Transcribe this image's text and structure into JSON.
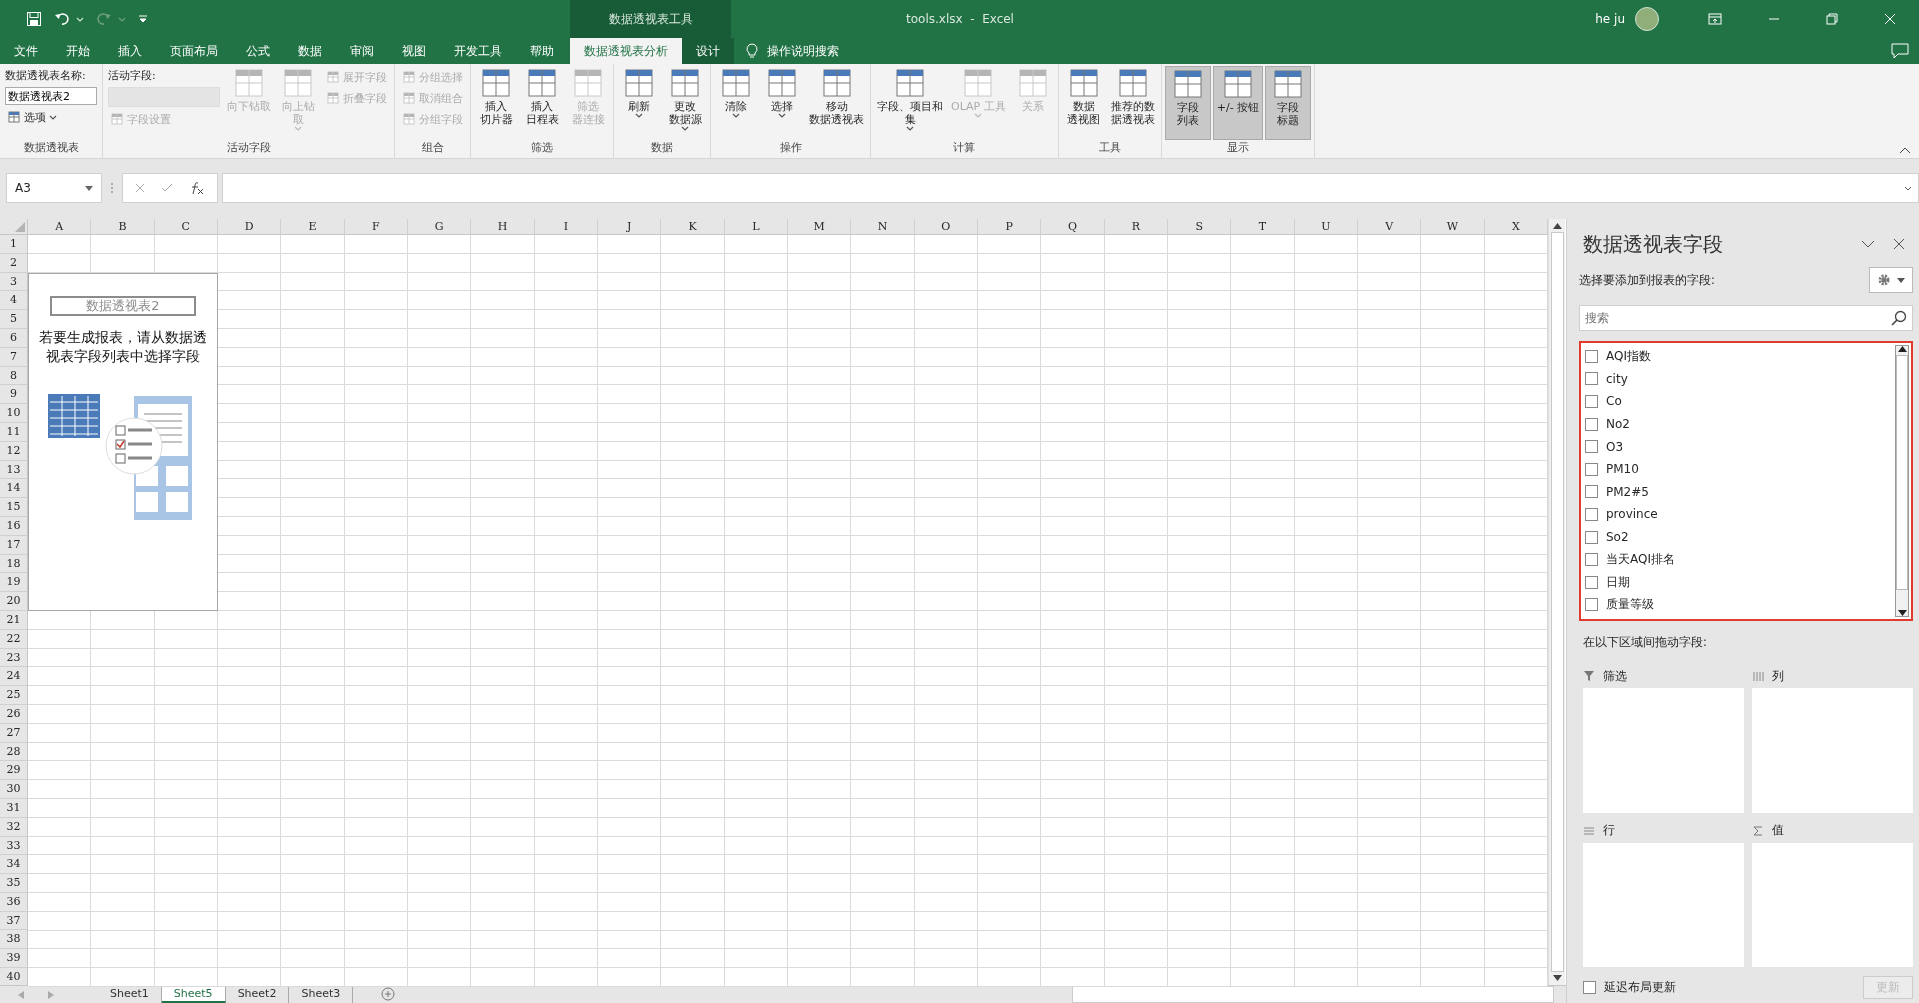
{
  "title_bar": {
    "context_label": "数据透视表工具",
    "title": "tools.xlsx  -  Excel",
    "user": "he ju",
    "redo_disabled": true
  },
  "ribbon_tabs": [
    {
      "label": "文件",
      "selected": false,
      "contextual": false
    },
    {
      "label": "开始",
      "selected": false,
      "contextual": false
    },
    {
      "label": "插入",
      "selected": false,
      "contextual": false
    },
    {
      "label": "页面布局",
      "selected": false,
      "contextual": false
    },
    {
      "label": "公式",
      "selected": false,
      "contextual": false
    },
    {
      "label": "数据",
      "selected": false,
      "contextual": false
    },
    {
      "label": "审阅",
      "selected": false,
      "contextual": false
    },
    {
      "label": "视图",
      "selected": false,
      "contextual": false
    },
    {
      "label": "开发工具",
      "selected": false,
      "contextual": false
    },
    {
      "label": "帮助",
      "selected": false,
      "contextual": false
    },
    {
      "label": "数据透视表分析",
      "selected": true,
      "contextual": true
    },
    {
      "label": "设计",
      "selected": false,
      "contextual": true
    }
  ],
  "tell_me": "操作说明搜索",
  "ribbon_groups": [
    {
      "label": "数据透视表",
      "items": [
        {
          "kind": "stack",
          "items": [
            {
              "kind": "caption",
              "label": "数据透视表名称:"
            },
            {
              "kind": "name_field",
              "value": "数据透视表2"
            },
            {
              "kind": "small",
              "label": "选项",
              "disabled": false,
              "dropdown": true
            }
          ]
        }
      ]
    },
    {
      "label": "活动字段",
      "items": [
        {
          "kind": "stack",
          "items": [
            {
              "kind": "caption",
              "label": "活动字段:"
            },
            {
              "kind": "active_field",
              "disabled": true
            },
            {
              "kind": "small",
              "label": "字段设置",
              "disabled": true,
              "dropdown": false
            }
          ]
        },
        {
          "kind": "large",
          "label": [
            "向下钻取"
          ],
          "disabled": true,
          "dropdown": false,
          "pressed": false
        },
        {
          "kind": "large",
          "label": [
            "向上钻",
            "取"
          ],
          "disabled": true,
          "dropdown": true,
          "pressed": false
        },
        {
          "kind": "stack",
          "items": [
            {
              "kind": "small",
              "label": "展开字段",
              "disabled": true,
              "dropdown": false
            },
            {
              "kind": "small",
              "label": "折叠字段",
              "disabled": true,
              "dropdown": false
            }
          ]
        }
      ]
    },
    {
      "label": "组合",
      "items": [
        {
          "kind": "stack",
          "items": [
            {
              "kind": "small",
              "label": "分组选择",
              "disabled": true,
              "dropdown": false
            },
            {
              "kind": "small",
              "label": "取消组合",
              "disabled": true,
              "dropdown": false
            },
            {
              "kind": "small",
              "label": "分组字段",
              "disabled": true,
              "dropdown": false
            }
          ]
        }
      ]
    },
    {
      "label": "筛选",
      "items": [
        {
          "kind": "large",
          "label": [
            "插入",
            "切片器"
          ],
          "disabled": false,
          "dropdown": false,
          "pressed": false
        },
        {
          "kind": "large",
          "label": [
            "插入",
            "日程表"
          ],
          "disabled": false,
          "dropdown": false,
          "pressed": false
        },
        {
          "kind": "large",
          "label": [
            "筛选",
            "器连接"
          ],
          "disabled": true,
          "dropdown": false,
          "pressed": false
        }
      ]
    },
    {
      "label": "数据",
      "items": [
        {
          "kind": "large",
          "label": [
            "刷新"
          ],
          "disabled": false,
          "dropdown": true,
          "pressed": false
        },
        {
          "kind": "large",
          "label": [
            "更改",
            "数据源"
          ],
          "disabled": false,
          "dropdown": true,
          "pressed": false
        }
      ]
    },
    {
      "label": "操作",
      "items": [
        {
          "kind": "large",
          "label": [
            "清除"
          ],
          "disabled": false,
          "dropdown": true,
          "pressed": false
        },
        {
          "kind": "large",
          "label": [
            "选择"
          ],
          "disabled": false,
          "dropdown": true,
          "pressed": false
        },
        {
          "kind": "large",
          "label": [
            "移动",
            "数据透视表"
          ],
          "disabled": false,
          "dropdown": false,
          "pressed": false
        }
      ]
    },
    {
      "label": "计算",
      "items": [
        {
          "kind": "large",
          "label": [
            "字段、项目和",
            "集"
          ],
          "disabled": false,
          "dropdown": true,
          "pressed": false
        },
        {
          "kind": "large",
          "label": [
            "OLAP 工具"
          ],
          "disabled": true,
          "dropdown": true,
          "pressed": false
        },
        {
          "kind": "large",
          "label": [
            "关系"
          ],
          "disabled": true,
          "dropdown": false,
          "pressed": false
        }
      ]
    },
    {
      "label": "工具",
      "items": [
        {
          "kind": "large",
          "label": [
            "数据",
            "透视图"
          ],
          "disabled": false,
          "dropdown": false,
          "pressed": false
        },
        {
          "kind": "large",
          "label": [
            "推荐的数",
            "据透视表"
          ],
          "disabled": false,
          "dropdown": false,
          "pressed": false
        }
      ]
    },
    {
      "label": "显示",
      "items": [
        {
          "kind": "large",
          "label": [
            "字段",
            "列表"
          ],
          "disabled": false,
          "dropdown": false,
          "pressed": true
        },
        {
          "kind": "large",
          "label": [
            "+/- 按钮"
          ],
          "disabled": false,
          "dropdown": false,
          "pressed": true
        },
        {
          "kind": "large",
          "label": [
            "字段",
            "标题"
          ],
          "disabled": false,
          "dropdown": false,
          "pressed": true
        }
      ]
    }
  ],
  "formula_bar": {
    "name_box": "A3"
  },
  "sheet": {
    "columns": [
      "A",
      "B",
      "C",
      "D",
      "E",
      "F",
      "G",
      "H",
      "I",
      "J",
      "K",
      "L",
      "M",
      "N",
      "O",
      "P",
      "Q",
      "R",
      "S",
      "T",
      "U",
      "V",
      "W",
      "X"
    ],
    "rows": [
      "1",
      "2",
      "3",
      "4",
      "5",
      "6",
      "7",
      "8",
      "9",
      "10",
      "11",
      "12",
      "13",
      "14",
      "15",
      "16",
      "17",
      "18",
      "19",
      "20",
      "21",
      "22",
      "23",
      "24",
      "25",
      "26",
      "27",
      "28",
      "29",
      "30",
      "31",
      "32",
      "33",
      "34",
      "35",
      "36",
      "37",
      "38",
      "39",
      "40"
    ],
    "pivot_placeholder": {
      "title": "数据透视表2",
      "message": "若要生成报表，请从数据透视表字段列表中选择字段"
    }
  },
  "sheet_tabs": [
    {
      "label": "Sheet1",
      "selected": false
    },
    {
      "label": "Sheet5",
      "selected": true
    },
    {
      "label": "Sheet2",
      "selected": false
    },
    {
      "label": "Sheet3",
      "selected": false
    }
  ],
  "field_pane": {
    "title": "数据透视表字段",
    "subtitle": "选择要添加到报表的字段:",
    "search": {
      "placeholder": "搜索"
    },
    "fields": [
      {
        "label": "AQI指数",
        "checked": false
      },
      {
        "label": "city",
        "checked": false
      },
      {
        "label": "Co",
        "checked": false
      },
      {
        "label": "No2",
        "checked": false
      },
      {
        "label": "O3",
        "checked": false
      },
      {
        "label": "PM10",
        "checked": false
      },
      {
        "label": "PM2#5",
        "checked": false
      },
      {
        "label": "province",
        "checked": false
      },
      {
        "label": "So2",
        "checked": false
      },
      {
        "label": "当天AQI排名",
        "checked": false
      },
      {
        "label": "日期",
        "checked": false
      },
      {
        "label": "质量等级",
        "checked": false
      }
    ],
    "areas_label": "在以下区域间拖动字段:",
    "areas": [
      {
        "kind": "filter",
        "label": "筛选"
      },
      {
        "kind": "columns",
        "label": "列"
      },
      {
        "kind": "rows",
        "label": "行"
      },
      {
        "kind": "values",
        "label": "值"
      }
    ],
    "defer_update": {
      "label": "延迟布局更新",
      "checked": false
    },
    "update_button": {
      "label": "更新",
      "disabled": true
    }
  }
}
